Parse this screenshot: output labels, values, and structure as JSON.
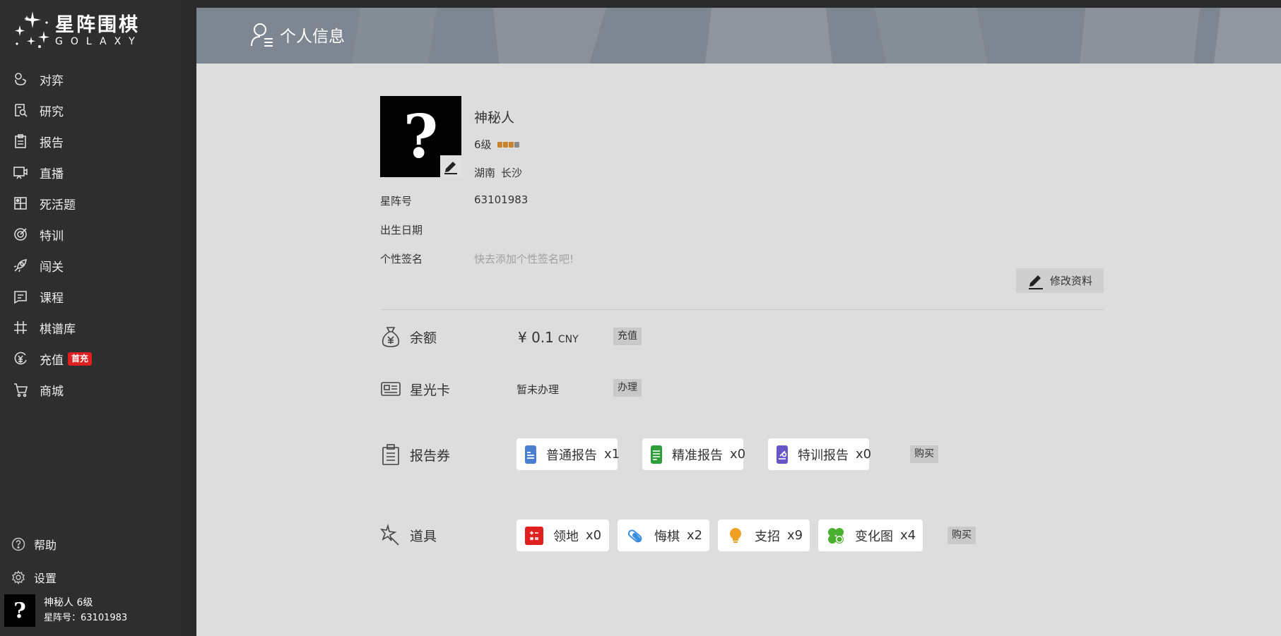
{
  "brand": {
    "name_cn": "星阵围棋",
    "name_en": "GOLAXY"
  },
  "sidebar": {
    "items": [
      {
        "label": "对弈",
        "icon": "hand-stone-icon"
      },
      {
        "label": "研究",
        "icon": "search-doc-icon"
      },
      {
        "label": "报告",
        "icon": "clipboard-icon"
      },
      {
        "label": "直播",
        "icon": "live-icon"
      },
      {
        "label": "死活题",
        "icon": "puzzle-board-icon"
      },
      {
        "label": "特训",
        "icon": "target-icon"
      },
      {
        "label": "闯关",
        "icon": "rocket-icon"
      },
      {
        "label": "课程",
        "icon": "course-icon"
      },
      {
        "label": "棋谱库",
        "icon": "grid-icon"
      },
      {
        "label": "充值",
        "icon": "yuan-coin-icon",
        "badge": "首充"
      },
      {
        "label": "商城",
        "icon": "cart-icon"
      }
    ],
    "help_label": "帮助",
    "settings_label": "设置",
    "user": {
      "name_level": "神秘人  6级",
      "id_line": "星阵号：63101983"
    }
  },
  "page": {
    "title": "个人信息"
  },
  "profile": {
    "avatar_glyph": "?",
    "name": "神秘人",
    "level": "6级",
    "level_progress": 0.75,
    "province": "湖南",
    "city": "长沙",
    "id_label": "星阵号",
    "id_value": "63101983",
    "birth_label": "出生日期",
    "birth_value": "",
    "signature_label": "个性签名",
    "signature_placeholder": "快去添加个性签名吧!",
    "edit_label": "修改资料"
  },
  "balance": {
    "label": "余额",
    "amount": "¥ 0.1",
    "currency": "CNY",
    "button": "充值"
  },
  "card": {
    "label": "星光卡",
    "status": "暂未办理",
    "button": "办理"
  },
  "report_coupons": {
    "label": "报告券",
    "buy": "购买",
    "items": [
      {
        "name": "普通报告",
        "count": "x1",
        "color": "#4a7fd0"
      },
      {
        "name": "精准报告",
        "count": "x0",
        "color": "#2e9e3a"
      },
      {
        "name": "特训报告",
        "count": "x0",
        "color": "#6a55c8"
      }
    ]
  },
  "props": {
    "label": "道具",
    "buy": "购买",
    "items": [
      {
        "name": "领地",
        "count": "x0",
        "color": "#e02020"
      },
      {
        "name": "悔棋",
        "count": "x2",
        "color": "#3a8de0"
      },
      {
        "name": "支招",
        "count": "x9",
        "color": "#f0a020"
      },
      {
        "name": "变化图",
        "count": "x4",
        "color": "#4ab030"
      }
    ]
  }
}
